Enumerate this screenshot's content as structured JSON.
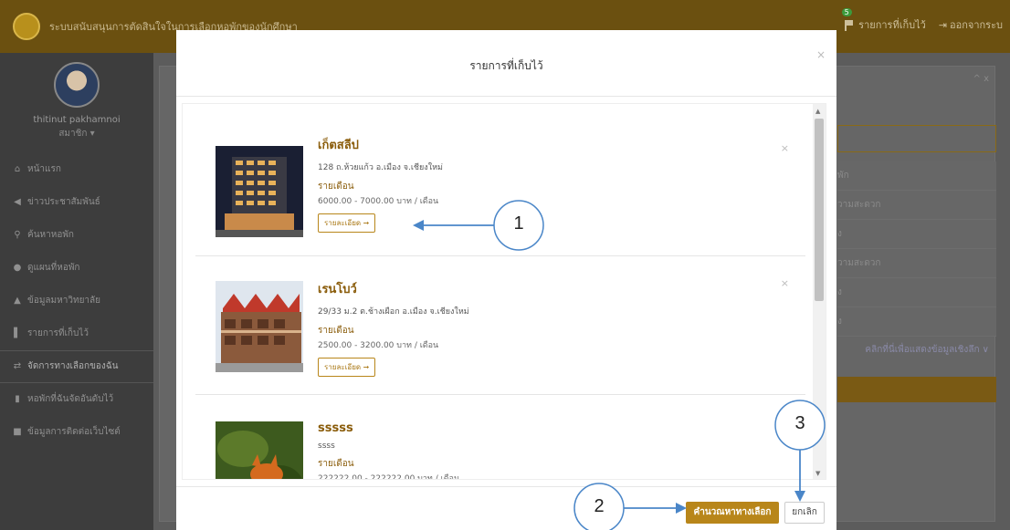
{
  "topbar": {
    "app_title": "ระบบสนับสนุนการตัดสินใจในการเลือกหอพักของนักศึกษา",
    "saved_count": "5",
    "saved_label": "รายการที่เก็บไว้",
    "logout_label": "ออกจากระบ"
  },
  "sidebar": {
    "user_name": "thitinut pakhamnoi",
    "user_role": "สมาชิก ▾",
    "items": [
      {
        "icon": "home-icon",
        "glyph": "⌂",
        "label": "หน้าแรก"
      },
      {
        "icon": "megaphone-icon",
        "glyph": "◀",
        "label": "ข่าวประชาสัมพันธ์"
      },
      {
        "icon": "search-icon",
        "glyph": "⚲",
        "label": "ค้นหาหอพัก"
      },
      {
        "icon": "map-marker-icon",
        "glyph": "●",
        "label": "ดูแผนที่หอพัก"
      },
      {
        "icon": "graduation-cap-icon",
        "glyph": "▲",
        "label": "ข้อมูลมหาวิทยาลัย"
      },
      {
        "icon": "flag-icon",
        "glyph": "▌",
        "label": "รายการที่เก็บไว้"
      },
      {
        "icon": "exchange-icon",
        "glyph": "⇄",
        "label": "จัดการทางเลือกของฉัน"
      },
      {
        "icon": "bar-chart-icon",
        "glyph": "▮",
        "label": "หอพักที่ฉันจัดอันดับไว้"
      },
      {
        "icon": "comment-icon",
        "glyph": "■",
        "label": "ข้อมูลการติดต่อเว็บไซต์"
      }
    ]
  },
  "background": {
    "rows": [
      "พัก",
      "วามสะดวก",
      "ง",
      "วามสะดวก",
      "ง",
      "ง"
    ],
    "more_link": "คลิกที่นี่เพื่อแสดงข้อมูลเชิงลึก ∨",
    "panel_controls": "^ x"
  },
  "modal": {
    "title": "รายการที่เก็บไว้",
    "close": "×",
    "items": [
      {
        "name": "เก็ตสลีป",
        "address": "128 ถ.ห้วยแก้ว อ.เมือง จ.เชียงใหม่",
        "monthly_label": "รายเดือน",
        "price": "6000.00 - 7000.00 บาท / เดือน",
        "detail_label": "รายละเอียด ➞",
        "remove": "×"
      },
      {
        "name": "เรนโบว์",
        "address": "29/33 ม.2 ต.ช้างเผือก อ.เมือง จ.เชียงใหม่",
        "monthly_label": "รายเดือน",
        "price": "2500.00 - 3200.00 บาท / เดือน",
        "detail_label": "รายละเอียด ➞",
        "remove": "×"
      },
      {
        "name": "sssss",
        "address": "ssss",
        "monthly_label": "รายเดือน",
        "price": "222222.00 - 222222.00 บาท / เดือน"
      }
    ],
    "search_label": "คำนวณหาทางเลือก",
    "cancel_label": "ยกเลิก"
  },
  "annotations": [
    "1",
    "2",
    "3"
  ],
  "colors": {
    "accent": "#b8861a",
    "annotation": "#4a86c8"
  }
}
